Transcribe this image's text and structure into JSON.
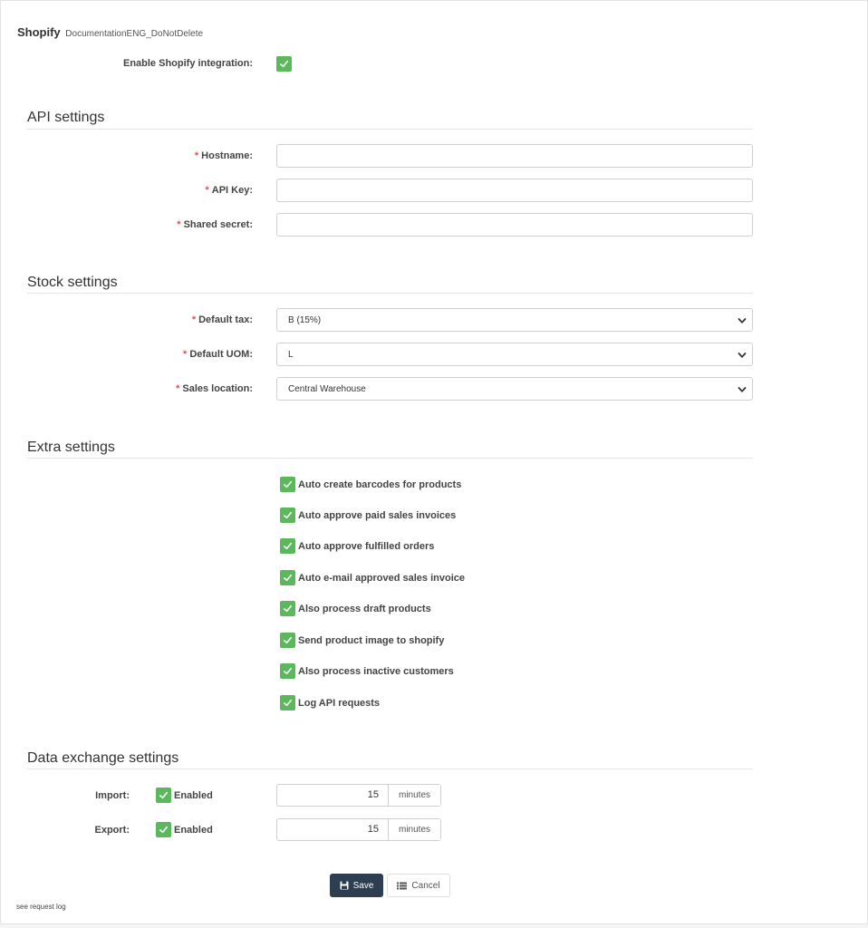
{
  "header": {
    "title": "Shopify",
    "subtitle": "DocumentationENG_DoNotDelete"
  },
  "enable": {
    "label": "Enable Shopify integration:",
    "checked": true
  },
  "api": {
    "heading": "API settings",
    "required_mark": "*",
    "hostname_label": "Hostname:",
    "hostname_value": "",
    "apikey_label": "API Key:",
    "apikey_value": "",
    "secret_label": "Shared secret:",
    "secret_value": ""
  },
  "stock": {
    "heading": "Stock settings",
    "tax_label": "Default tax:",
    "tax_value": "B (15%)",
    "uom_label": "Default UOM:",
    "uom_value": "L",
    "location_label": "Sales location:",
    "location_value": "Central Warehouse"
  },
  "extra": {
    "heading": "Extra settings",
    "options": [
      {
        "label": "Auto create barcodes for products",
        "checked": true
      },
      {
        "label": "Auto approve paid sales invoices",
        "checked": true
      },
      {
        "label": "Auto approve fulfilled orders",
        "checked": true
      },
      {
        "label": "Auto e-mail approved sales invoice",
        "checked": true
      },
      {
        "label": "Also process draft products",
        "checked": true
      },
      {
        "label": "Send product image to shopify",
        "checked": true
      },
      {
        "label": "Also process inactive customers",
        "checked": true
      },
      {
        "label": "Log API requests",
        "checked": true
      }
    ]
  },
  "exchange": {
    "heading": "Data exchange settings",
    "import_label": "Import:",
    "import_enabled_label": "Enabled",
    "import_interval": "15",
    "import_unit": "minutes",
    "export_label": "Export:",
    "export_enabled_label": "Enabled",
    "export_interval": "15",
    "export_unit": "minutes"
  },
  "actions": {
    "save_label": "Save",
    "cancel_label": "Cancel"
  },
  "footer": {
    "request_log_link": "see request log"
  },
  "colors": {
    "check_green": "#5cb85c",
    "save_dark": "#2c3e50",
    "required_red": "#d9534f"
  }
}
